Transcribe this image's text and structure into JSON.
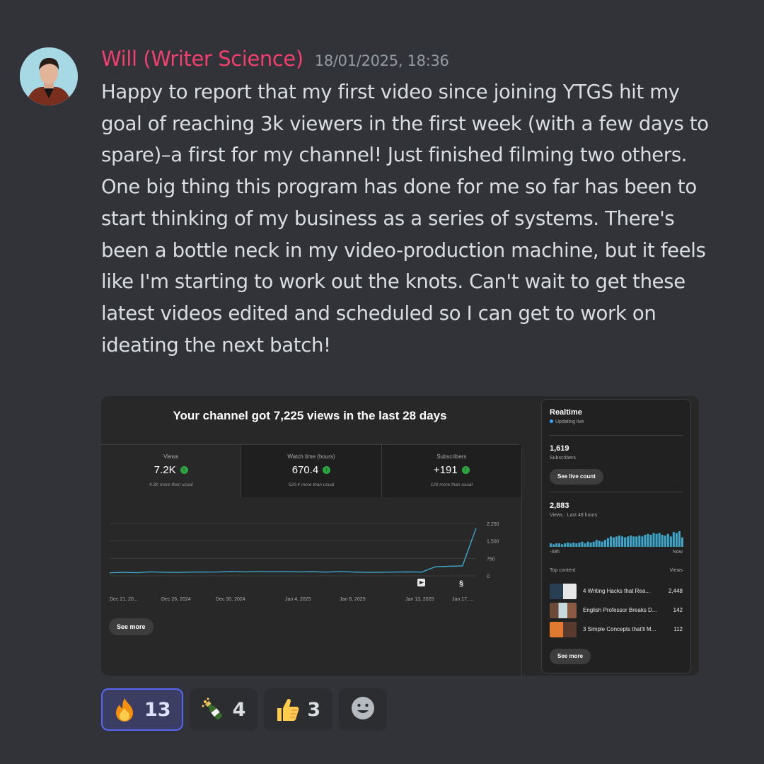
{
  "message": {
    "author": "Will (Writer Science)",
    "timestamp": "18/01/2025, 18:36",
    "author_color": "#f23f6f",
    "paragraphs": [
      "Happy to report that my first video since joining YTGS hit my goal of reaching 3k viewers in the first week (with a few days to spare)–a first for my channel! Just finished filming two others.",
      "One big thing this program has done for me so far has been to start thinking of my business as a series of systems. There's been a bottle neck in my video-production machine, but it feels like I'm starting to work out the knots. Can't wait to get these latest videos edited and scheduled so I can get to work on ideating the next batch!"
    ]
  },
  "analytics": {
    "title": "Your channel got 7,225 views in the last 28 days",
    "metrics": [
      {
        "label": "Views",
        "value": "7.2K",
        "note": "4.3K more than usual"
      },
      {
        "label": "Watch time (hours)",
        "value": "670.4",
        "note": "520.4 more than usual"
      },
      {
        "label": "Subscribers",
        "value": "+191",
        "note": "129 more than usual"
      }
    ],
    "see_more": "See more",
    "chart_data": {
      "type": "line",
      "x": [
        "Dec 21, 20...",
        "Dec 26, 2024",
        "Dec 30, 2024",
        "Jan 4, 2025",
        "Jan 8, 2025",
        "Jan 13, 2025",
        "Jan 17, ..."
      ],
      "y_ticks": [
        "2,250",
        "1,500",
        "750",
        "0"
      ],
      "ylim": [
        0,
        2250
      ],
      "series": [
        {
          "values": [
            130,
            150,
            135,
            170,
            155,
            150,
            160,
            160,
            165,
            190,
            170,
            180,
            175,
            180,
            170,
            175,
            160,
            185,
            160,
            150,
            155,
            160,
            170,
            160,
            390,
            410,
            430,
            2050
          ]
        }
      ],
      "color": "#3ea6c8"
    },
    "realtime": {
      "title": "Realtime",
      "status": "Updating live",
      "subscribers_value": "1,619",
      "subscribers_label": "Subscribers",
      "see_live_count": "See live count",
      "views_value": "2,883",
      "views_label": "Views · Last 48 hours",
      "bars_start": "-48h",
      "bars_end": "Now",
      "bars": [
        4,
        3,
        4,
        4,
        3,
        4,
        5,
        4,
        5,
        4,
        5,
        6,
        4,
        6,
        5,
        6,
        8,
        7,
        6,
        8,
        10,
        12,
        11,
        12,
        13,
        12,
        11,
        12,
        13,
        12,
        12,
        13,
        12,
        14,
        15,
        14,
        16,
        15,
        16,
        14,
        13,
        15,
        12,
        17,
        16,
        18,
        11
      ],
      "top_content_label": "Top content",
      "views_col_label": "Views",
      "top_content": [
        {
          "title": "4 Writing Hacks that Rea...",
          "views": "2,448"
        },
        {
          "title": "English Professor Breaks D...",
          "views": "142"
        },
        {
          "title": "3 Simple Concepts that'll M...",
          "views": "112"
        }
      ],
      "see_more": "See more"
    }
  },
  "reactions": [
    {
      "emoji": "fire",
      "count": "13",
      "me": true
    },
    {
      "emoji": "champagne",
      "count": "4",
      "me": false
    },
    {
      "emoji": "thumbs-up",
      "count": "3",
      "me": false
    }
  ]
}
